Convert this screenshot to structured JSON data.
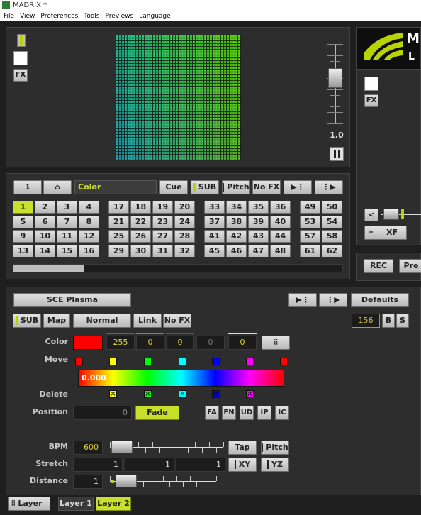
{
  "window": {
    "title": "MADRIX *"
  },
  "menu": [
    "File",
    "View",
    "Preferences",
    "Tools",
    "Previews",
    "Language"
  ],
  "preview": {
    "fx_label": "FX",
    "speed": "1.0"
  },
  "right_preview": {
    "fx_label": "FX",
    "rec_label": "REC",
    "pre_label": "Pre",
    "xf_label": "XF"
  },
  "storage_bar": {
    "page": "1",
    "color_label": "Color",
    "cue": "Cue",
    "sub": "SUB",
    "pitch": "Pitch",
    "nofx": "No FX"
  },
  "storage_places": {
    "group1": [
      "1",
      "2",
      "3",
      "4",
      "5",
      "6",
      "7",
      "8",
      "9",
      "10",
      "11",
      "12",
      "13",
      "14",
      "15",
      "16"
    ],
    "group2": [
      "17",
      "18",
      "19",
      "20",
      "21",
      "22",
      "23",
      "24",
      "25",
      "26",
      "27",
      "28",
      "29",
      "30",
      "31",
      "32"
    ],
    "group3": [
      "33",
      "34",
      "35",
      "36",
      "37",
      "38",
      "39",
      "40",
      "41",
      "42",
      "43",
      "44",
      "45",
      "46",
      "47",
      "48"
    ],
    "group4": [
      "49",
      "50",
      "53",
      "54",
      "57",
      "58",
      "61",
      "62"
    ]
  },
  "effect": {
    "name": "SCE Plasma",
    "defaults": "Defaults",
    "sub": "SUB",
    "map": "Map",
    "mix": "Normal",
    "link": "Link",
    "nofx": "No FX",
    "submaster": "156",
    "b": "B",
    "s": "S"
  },
  "params": {
    "color_label": "Color",
    "color_values": [
      "255",
      "0",
      "0",
      "0",
      "0"
    ],
    "move_label": "Move",
    "gradient_value": "0.000",
    "delete_label": "Delete",
    "position_label": "Position",
    "position_value": "0",
    "fade": "Fade",
    "pos_buttons": [
      "FA",
      "FN",
      "UD",
      "IP",
      "IC"
    ],
    "bpm_label": "BPM",
    "bpm_value": "600",
    "tap": "Tap",
    "pitch": "Pitch",
    "stretch_label": "Stretch",
    "stretch_values": [
      "1",
      "1",
      "1"
    ],
    "xy": "XY",
    "yz": "YZ",
    "distance_label": "Distance",
    "distance_value": "1"
  },
  "colors": {
    "accent": "#c8e02c",
    "red": "#ff0000"
  },
  "gradient_stops": [
    "#ff0000",
    "#ffff00",
    "#00ff00",
    "#00ffff",
    "#0000ff",
    "#ff00ff",
    "#ff0000"
  ],
  "move_swatches": [
    "#ff0000",
    "#ffff00",
    "#00ff00",
    "#00ffff",
    "#0000ff",
    "#ff00ff",
    "#ff0000"
  ],
  "delete_swatches": [
    "#ffff00",
    "#00ff00",
    "#00ffff",
    "#0000ff",
    "#ff00ff"
  ],
  "tabs": {
    "layer_icon_label": "Layer",
    "layer1": "Layer 1",
    "layer2": "Layer 2"
  }
}
